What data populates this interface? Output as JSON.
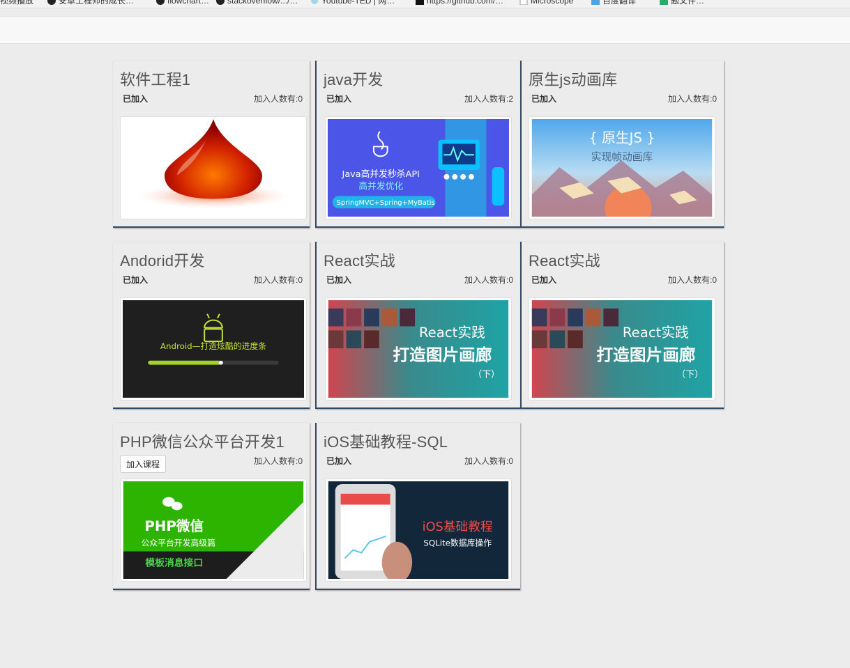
{
  "bookmarks": [
    "视频播放",
    "安卓工程师的成长…",
    "flowchart…",
    "stackoverflow/.../…",
    "Youtube-TED | 网…",
    "https://github.com/…",
    "Microscope",
    "百度翻译",
    "题文件…"
  ],
  "courses": [
    {
      "title": "软件工程1",
      "status": "已加入",
      "count": "加入人数有:0",
      "art": "drop"
    },
    {
      "title": "java开发",
      "status": "已加入",
      "count": "加入人数有:2",
      "art": "java",
      "art_text": [
        "Java高并发秒杀API",
        "高并发优化",
        "SpringMVC+Spring+MyBatis"
      ]
    },
    {
      "title": "原生js动画库",
      "status": "已加入",
      "count": "加入人数有:0",
      "art": "js",
      "art_text": [
        "{ 原生JS }",
        "实现帧动画库"
      ]
    },
    {
      "title": "Andorid开发",
      "status": "已加入",
      "count": "加入人数有:0",
      "art": "android",
      "art_text": [
        "Android—打造炫酷的进度条"
      ]
    },
    {
      "title": "React实战",
      "status": "已加入",
      "count": "加入人数有:0",
      "art": "react",
      "art_text": [
        "React实践",
        "打造图片画廊",
        "（下）"
      ]
    },
    {
      "title": "React实战",
      "status": "已加入",
      "count": "加入人数有:0",
      "art": "react",
      "art_text": [
        "React实践",
        "打造图片画廊",
        "（下）"
      ]
    },
    {
      "title": "PHP微信公众平台开发1",
      "button": "加入课程",
      "count": "加入人数有:0",
      "art": "php",
      "art_text": [
        "PHP微信",
        "公众平台开发高级篇",
        "模板消息接口"
      ]
    },
    {
      "title": "iOS基础教程-SQL",
      "status": "已加入",
      "count": "加入人数有:0",
      "art": "ios",
      "art_text": [
        "iOS基础教程",
        "SQLite数据库操作"
      ]
    }
  ],
  "colors": {
    "accent_border": "#2e4a66",
    "background": "#ececec"
  }
}
